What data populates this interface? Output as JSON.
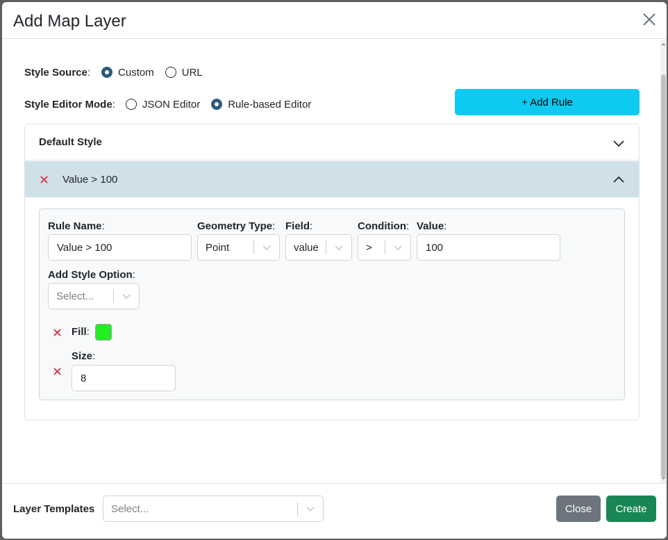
{
  "modal": {
    "title": "Add Map Layer"
  },
  "style_source": {
    "label": "Style Source",
    "options": [
      {
        "label": "Custom",
        "checked": true
      },
      {
        "label": "URL",
        "checked": false
      }
    ]
  },
  "style_editor_mode": {
    "label": "Style Editor Mode",
    "options": [
      {
        "label": "JSON Editor",
        "checked": false
      },
      {
        "label": "Rule-based Editor",
        "checked": true
      }
    ]
  },
  "add_rule_button": "+ Add Rule",
  "accordion": {
    "default_style": "Default Style",
    "active_rule_title": "Value > 100"
  },
  "rule": {
    "rule_name_label": "Rule Name",
    "rule_name_value": "Value > 100",
    "geometry_type_label": "Geometry Type",
    "geometry_type_value": "Point",
    "field_label": "Field",
    "field_value": "value",
    "condition_label": "Condition",
    "condition_value": ">",
    "value_label": "Value",
    "value_value": "100",
    "add_style_option_label": "Add Style Option",
    "add_style_option_placeholder": "Select...",
    "fill_label": "Fill",
    "fill_color": "#22ee22",
    "size_label": "Size",
    "size_value": "8"
  },
  "footer": {
    "layer_templates_label": "Layer Templates",
    "layer_templates_placeholder": "Select...",
    "close_label": "Close",
    "create_label": "Create"
  },
  "colors": {
    "accent_radio": "#2c5a7a",
    "add_rule_bg": "#0dcaf0",
    "active_header_bg": "#cfe0e8",
    "close_bg": "#6c757d",
    "create_bg": "#198754",
    "delete_icon": "#dc3545"
  }
}
